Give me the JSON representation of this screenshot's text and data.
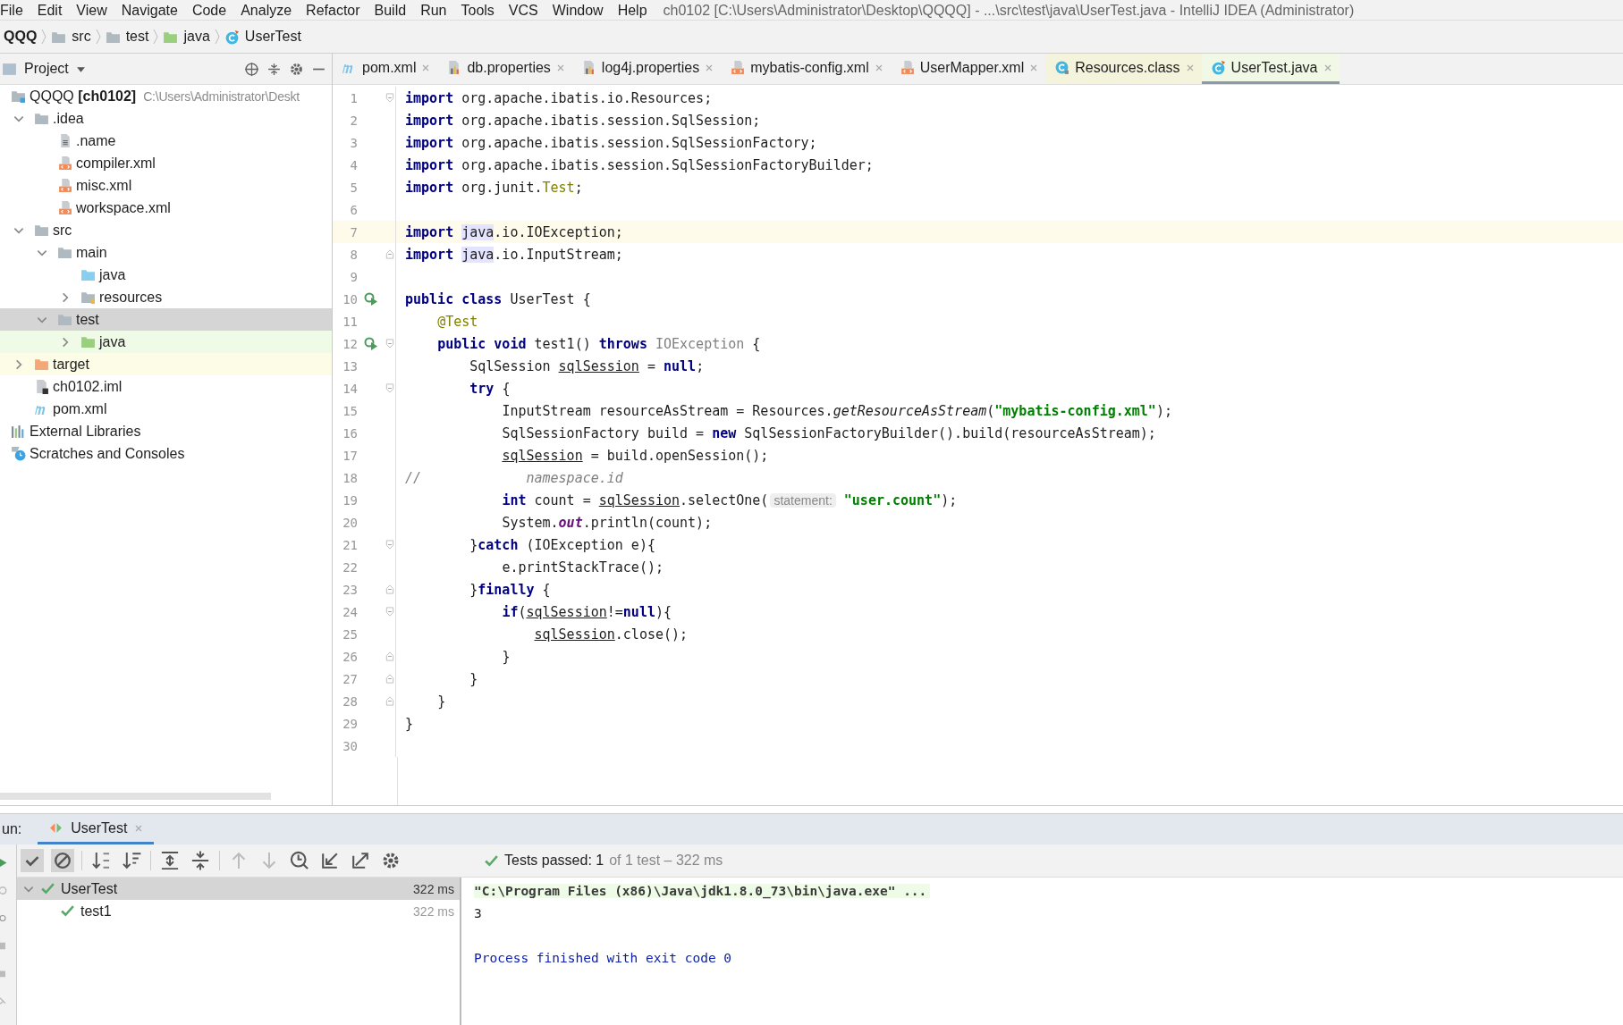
{
  "menu": [
    "File",
    "Edit",
    "View",
    "Navigate",
    "Code",
    "Analyze",
    "Refactor",
    "Build",
    "Run",
    "Tools",
    "VCS",
    "Window",
    "Help"
  ],
  "window": {
    "title": "ch0102 [C:\\Users\\Administrator\\Desktop\\QQQQ] - ...\\src\\test\\java\\UserTest.java - IntelliJ IDEA (Administrator)"
  },
  "breadcrumbs": [
    {
      "label": "QQQ",
      "kind": "project"
    },
    {
      "label": "src",
      "kind": "folder"
    },
    {
      "label": "test",
      "kind": "folder"
    },
    {
      "label": "java",
      "kind": "test-folder"
    },
    {
      "label": "UserTest",
      "kind": "test-class"
    }
  ],
  "project_panel": {
    "title": "Project",
    "tree": [
      {
        "label": "QQQQ **[ch0102]**",
        "path": "C:\\Users\\Administrator\\Deskt",
        "kind": "module",
        "selected": false,
        "children": [
          {
            "label": ".idea",
            "kind": "folder",
            "selected": false,
            "expanded": true,
            "children": [
              {
                "label": ".name",
                "kind": "text",
                "selected": false
              },
              {
                "label": "compiler.xml",
                "kind": "xml",
                "selected": false
              },
              {
                "label": "misc.xml",
                "kind": "xml",
                "selected": false
              },
              {
                "label": "workspace.xml",
                "kind": "xml",
                "selected": false
              }
            ]
          },
          {
            "label": "src",
            "kind": "folder",
            "selected": false,
            "expanded": true,
            "children": [
              {
                "label": "main",
                "kind": "folder",
                "selected": false,
                "expanded": true,
                "children": [
                  {
                    "label": "java",
                    "kind": "source-folder",
                    "selected": false
                  },
                  {
                    "label": "resources",
                    "kind": "resource-folder",
                    "selected": false,
                    "expanded": false
                  }
                ]
              },
              {
                "label": "test",
                "kind": "folder",
                "selected": true,
                "expanded": true,
                "children": [
                  {
                    "label": "java",
                    "kind": "test-folder",
                    "selected": false,
                    "expanded": false
                  }
                ]
              }
            ]
          },
          {
            "label": "target",
            "kind": "excluded-folder",
            "selected": false,
            "expanded": false
          },
          {
            "label": "ch0102.iml",
            "kind": "iml",
            "selected": false
          },
          {
            "label": "pom.xml",
            "kind": "maven",
            "selected": false
          }
        ]
      },
      {
        "label": "External Libraries",
        "kind": "libraries",
        "selected": false
      },
      {
        "label": "Scratches and Consoles",
        "kind": "scratches",
        "selected": false
      }
    ]
  },
  "tabs": [
    {
      "label": "pom.xml",
      "kind": "maven",
      "selected": false
    },
    {
      "label": "db.properties",
      "kind": "properties",
      "selected": false
    },
    {
      "label": "log4j.properties",
      "kind": "properties",
      "selected": false
    },
    {
      "label": "mybatis-config.xml",
      "kind": "xml",
      "selected": false
    },
    {
      "label": "UserMapper.xml",
      "kind": "xml",
      "selected": false
    },
    {
      "label": "Resources.class",
      "kind": "library-class",
      "selected": false
    },
    {
      "label": "UserTest.java",
      "kind": "test-class",
      "selected": true
    }
  ],
  "editor": {
    "lines": [
      {
        "number": "1",
        "fold_start": true,
        "tokens": [
          {
            "kind": "kw",
            "text": "import"
          },
          {
            "kind": "plain",
            "text": " org.apache.ibatis.io.Resources;"
          }
        ]
      },
      {
        "number": "2",
        "tokens": [
          {
            "kind": "kw",
            "text": "import"
          },
          {
            "kind": "plain",
            "text": " org.apache.ibatis.session.SqlSession;"
          }
        ]
      },
      {
        "number": "3",
        "tokens": [
          {
            "kind": "kw",
            "text": "import"
          },
          {
            "kind": "plain",
            "text": " org.apache.ibatis.session.SqlSessionFactory;"
          }
        ]
      },
      {
        "number": "4",
        "tokens": [
          {
            "kind": "kw",
            "text": "import"
          },
          {
            "kind": "plain",
            "text": " org.apache.ibatis.session.SqlSessionFactoryBuilder;"
          }
        ]
      },
      {
        "number": "5",
        "tokens": [
          {
            "kind": "kw",
            "text": "import"
          },
          {
            "kind": "plain",
            "text": " org.junit."
          },
          {
            "kind": "ann",
            "text": "Test"
          },
          {
            "kind": "plain",
            "text": ";"
          }
        ]
      },
      {
        "number": "6"
      },
      {
        "number": "7",
        "current": true,
        "tokens": [
          {
            "kind": "kw",
            "text": "import "
          },
          {
            "kind": "mark",
            "text": "java"
          },
          {
            "kind": "plain",
            "text": ".io.IOException;"
          }
        ]
      },
      {
        "number": "8",
        "fold_end": true,
        "tokens": [
          {
            "kind": "kw",
            "text": "import "
          },
          {
            "kind": "mark",
            "text": "java"
          },
          {
            "kind": "plain",
            "text": ".io.InputStream;"
          }
        ]
      },
      {
        "number": "9"
      },
      {
        "number": "10",
        "run": true,
        "tokens": [
          {
            "kind": "kw",
            "text": "public class"
          },
          {
            "kind": "plain",
            "text": " UserTest {"
          }
        ]
      },
      {
        "number": "11",
        "tokens": [
          {
            "kind": "ann",
            "text": "    @Test"
          }
        ]
      },
      {
        "number": "12",
        "run": true,
        "fold_start": true,
        "tokens": [
          {
            "kind": "kw",
            "text": "    public void"
          },
          {
            "kind": "plain",
            "text": " test1() "
          },
          {
            "kind": "kw",
            "text": "throws "
          },
          {
            "kind": "grey",
            "text": "IOException"
          },
          {
            "kind": "plain",
            "text": " {"
          }
        ]
      },
      {
        "number": "13",
        "tokens": [
          {
            "kind": "plain",
            "text": "        SqlSession "
          },
          {
            "kind": "ul",
            "text": "sqlSession"
          },
          {
            "kind": "plain",
            "text": " = "
          },
          {
            "kind": "kw",
            "text": "null"
          },
          {
            "kind": "plain",
            "text": ";"
          }
        ]
      },
      {
        "number": "14",
        "fold_start": true,
        "tokens": [
          {
            "kind": "kw",
            "text": "        try"
          },
          {
            "kind": "plain",
            "text": " {"
          }
        ]
      },
      {
        "number": "15",
        "tokens": [
          {
            "kind": "plain",
            "text": "            InputStream resourceAsStream = Resources."
          },
          {
            "kind": "it",
            "text": "getResourceAsStream"
          },
          {
            "kind": "plain",
            "text": "("
          },
          {
            "kind": "str",
            "text": "\"mybatis-config.xml\""
          },
          {
            "kind": "plain",
            "text": ");"
          }
        ]
      },
      {
        "number": "16",
        "tokens": [
          {
            "kind": "plain",
            "text": "            SqlSessionFactory build = "
          },
          {
            "kind": "kw",
            "text": "new"
          },
          {
            "kind": "plain",
            "text": " SqlSessionFactoryBuilder().build(resourceAsStream);"
          }
        ]
      },
      {
        "number": "17",
        "tokens": [
          {
            "kind": "ul",
            "text": "            sqlSession"
          },
          {
            "kind": "plain",
            "text": " = build.openSession();"
          }
        ]
      },
      {
        "number": "18",
        "tokens": [
          {
            "kind": "comment",
            "text": "//             namespace.id"
          }
        ]
      },
      {
        "number": "19",
        "tokens": [
          {
            "kind": "kw",
            "text": "            int"
          },
          {
            "kind": "plain",
            "text": " count = "
          },
          {
            "kind": "ul",
            "text": "sqlSession"
          },
          {
            "kind": "plain",
            "text": ".selectOne("
          },
          {
            "kind": "hint",
            "text": "statement:"
          },
          {
            "kind": "str",
            "text": " \"user.count\""
          },
          {
            "kind": "plain",
            "text": ");"
          }
        ]
      },
      {
        "number": "20",
        "tokens": [
          {
            "kind": "plain",
            "text": "            System."
          },
          {
            "kind": "field",
            "text": "out"
          },
          {
            "kind": "plain",
            "text": ".println(count);"
          }
        ]
      },
      {
        "number": "21",
        "fold_start": true,
        "tokens": [
          {
            "kind": "plain",
            "text": "        }"
          },
          {
            "kind": "kw",
            "text": "catch"
          },
          {
            "kind": "plain",
            "text": " (IOException e){"
          }
        ]
      },
      {
        "number": "22",
        "tokens": [
          {
            "kind": "plain",
            "text": "            e.printStackTrace();"
          }
        ]
      },
      {
        "number": "23",
        "fold_end": true,
        "tokens": [
          {
            "kind": "plain",
            "text": "        }"
          },
          {
            "kind": "kw",
            "text": "finally"
          },
          {
            "kind": "plain",
            "text": " {"
          }
        ]
      },
      {
        "number": "24",
        "fold_start": true,
        "tokens": [
          {
            "kind": "kw",
            "text": "            if"
          },
          {
            "kind": "plain",
            "text": "("
          },
          {
            "kind": "ul",
            "text": "sqlSession"
          },
          {
            "kind": "plain",
            "text": "!="
          },
          {
            "kind": "kw",
            "text": "null"
          },
          {
            "kind": "plain",
            "text": "){"
          }
        ]
      },
      {
        "number": "25",
        "tokens": [
          {
            "kind": "ul",
            "text": "                sqlSession"
          },
          {
            "kind": "plain",
            "text": ".close();"
          }
        ]
      },
      {
        "number": "26",
        "fold_end": true,
        "tokens": [
          {
            "kind": "plain",
            "text": "            }"
          }
        ]
      },
      {
        "number": "27",
        "fold_end": true,
        "tokens": [
          {
            "kind": "plain",
            "text": "        }"
          }
        ]
      },
      {
        "number": "28",
        "fold_end": true,
        "tokens": [
          {
            "kind": "plain",
            "text": "    }"
          }
        ]
      },
      {
        "number": "29",
        "tokens": [
          {
            "kind": "plain",
            "text": "}"
          }
        ]
      },
      {
        "number": "30"
      }
    ]
  },
  "run_panel": {
    "label": "un:",
    "tabs": [
      {
        "label": "UserTest",
        "selected": true
      }
    ],
    "status": {
      "main": "Tests passed: 1",
      "detail": "of 1 test – 322 ms"
    },
    "tests": [
      {
        "name": "UserTest",
        "time": "322 ms",
        "selected": true,
        "expanded": true,
        "children": [
          {
            "name": "test1",
            "time": "322 ms",
            "selected": false
          }
        ]
      }
    ],
    "console": [
      {
        "kind": "command",
        "text": "\"C:\\Program Files (x86)\\Java\\jdk1.8.0_73\\bin\\java.exe\" ..."
      },
      {
        "kind": "output",
        "text": "3"
      },
      {
        "kind": "blank"
      },
      {
        "kind": "exit",
        "text": "Process finished with exit code 0"
      }
    ]
  }
}
